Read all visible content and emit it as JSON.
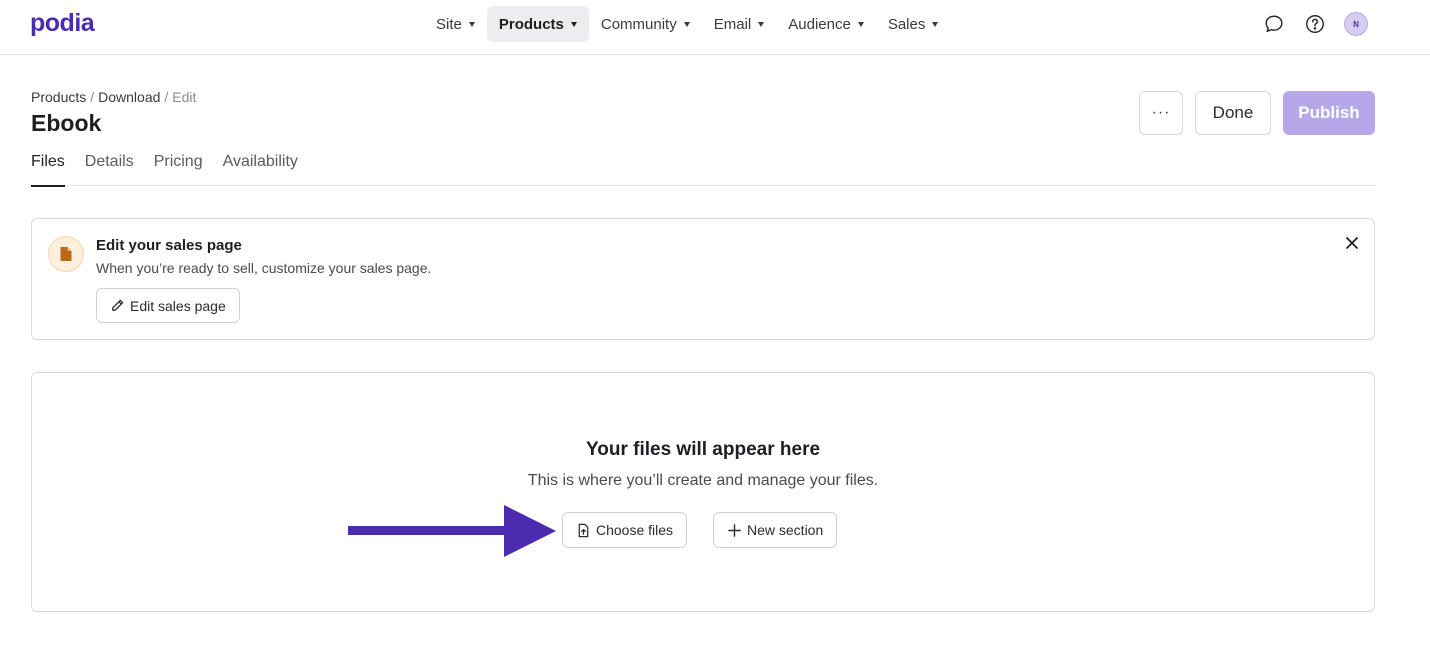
{
  "brand": {
    "logo": "podia",
    "accent": "#4b2bb0"
  },
  "nav": {
    "items": [
      {
        "label": "Site"
      },
      {
        "label": "Products"
      },
      {
        "label": "Community"
      },
      {
        "label": "Email"
      },
      {
        "label": "Audience"
      },
      {
        "label": "Sales"
      }
    ],
    "active": "Products",
    "avatar_initial": "N"
  },
  "breadcrumb": {
    "part1": "Products",
    "sep": "/",
    "part2": "Download",
    "current": "Edit"
  },
  "page": {
    "title": "Ebook"
  },
  "actions": {
    "more_label": "···",
    "done_label": "Done",
    "publish_label": "Publish",
    "publish_color": "#b6a8e8"
  },
  "tabs": [
    {
      "label": "Files"
    },
    {
      "label": "Details"
    },
    {
      "label": "Pricing"
    },
    {
      "label": "Availability"
    }
  ],
  "active_tab": "Files",
  "sales_card": {
    "icon": "document-icon",
    "title": "Edit your sales page",
    "description": "When you’re ready to sell, customize your sales page.",
    "button_label": "Edit sales page"
  },
  "files_card": {
    "title": "Your files will appear here",
    "description": "This is where you’ll create and manage your files.",
    "choose_label": "Choose files",
    "new_section_label": "New section"
  },
  "annotation": {
    "arrow_color": "#4b2bb0"
  }
}
